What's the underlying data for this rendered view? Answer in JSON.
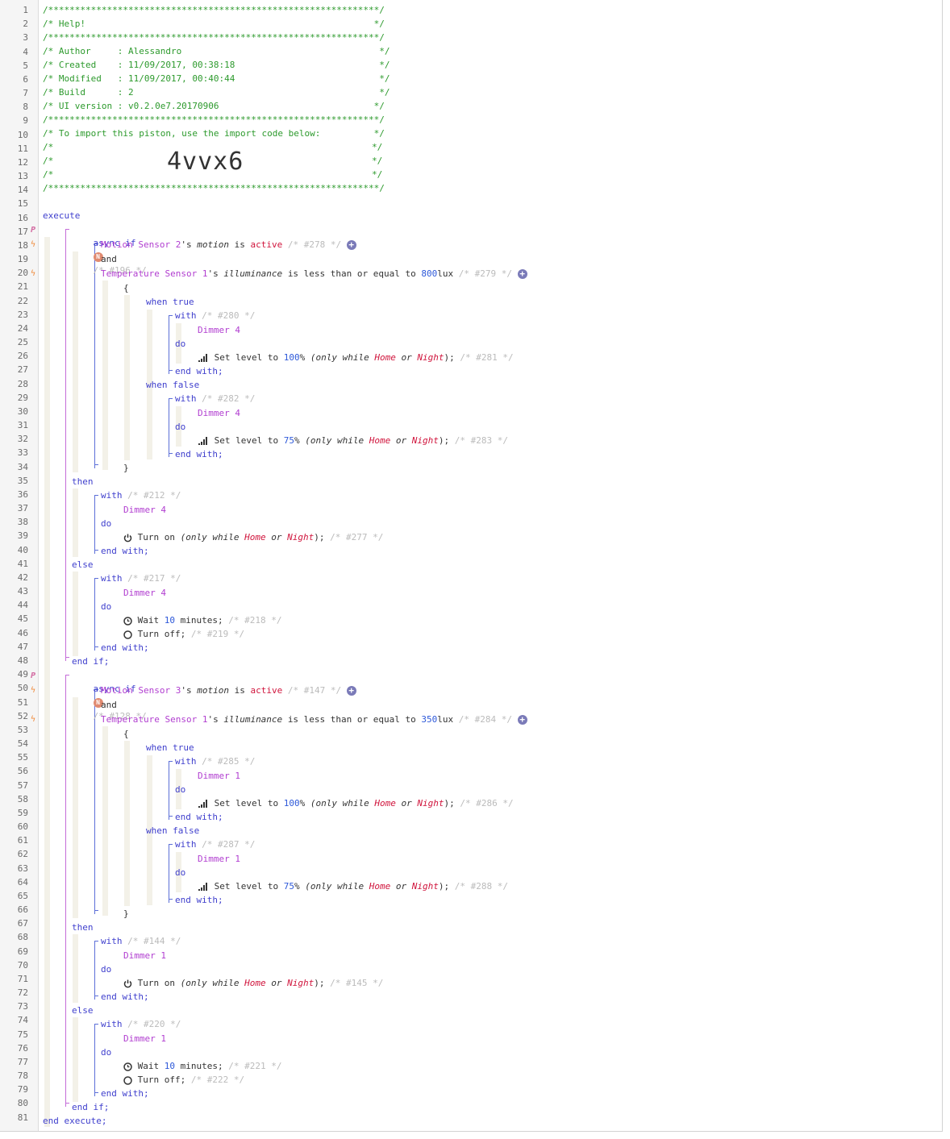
{
  "header": {
    "border": "/**************************************************************/",
    "help": "/* Help!                                                      */",
    "author": "/* Author     : Alessandro                                     */",
    "created": "/* Created    : 11/09/2017, 00:38:18                           */",
    "modified": "/* Modified   : 11/09/2017, 00:40:44                           */",
    "build": "/* Build      : 2                                              */",
    "ui_version": "/* UI version : v0.2.0e7.20170906                             */",
    "import_note": "/* To import this piston, use the import code below:          */",
    "blank_open": "/*",
    "blank_close": "*/",
    "import_code": "4vvx6"
  },
  "kw": {
    "execute": "execute",
    "end_execute": "end execute;",
    "async_if": "async if",
    "and": "and",
    "open_brace": "{",
    "close_brace": "}",
    "when_true": "when true",
    "when_false": "when false",
    "with": "with",
    "do": "do",
    "end_with": "end with;",
    "then": "then",
    "else": "else",
    "end_if": "end if;",
    "badge_n": "N",
    "plus": "+"
  },
  "text": {
    "s_possessive": "'s",
    "motion": "motion",
    "is": "is",
    "active": "active",
    "illuminance": "illuminance",
    "lte": "is less than or equal to",
    "lux": "lux",
    "set_level_to": "Set level to",
    "pct": "%",
    "only_while": "(only while",
    "home": "Home",
    "or": "or",
    "night": "Night",
    "close_paren_semi": ");",
    "turn_on": "Turn on",
    "turn_off": "Turn off;",
    "wait": "Wait",
    "minutes": "minutes;"
  },
  "block1": {
    "if_id": "/* #196 */",
    "motion_sensor": "Motion Sensor 2",
    "motion_id": "/* #278 */",
    "temp_sensor": "Temperature Sensor 1",
    "lux_value": "800",
    "lux_id": "/* #279 */",
    "true_with_id": "/* #280 */",
    "true_device": "Dimmer 4",
    "true_level": "100",
    "true_level_id": "/* #281 */",
    "false_with_id": "/* #282 */",
    "false_device": "Dimmer 4",
    "false_level": "75",
    "false_level_id": "/* #283 */",
    "then_with_id": "/* #212 */",
    "then_device": "Dimmer 4",
    "then_on_id": "/* #277 */",
    "else_with_id": "/* #217 */",
    "else_device": "Dimmer 4",
    "wait_value": "10",
    "wait_id": "/* #218 */",
    "off_id": "/* #219 */"
  },
  "block2": {
    "if_id": "/* #128 */",
    "motion_sensor": "Motion Sensor 3",
    "motion_id": "/* #147 */",
    "temp_sensor": "Temperature Sensor 1",
    "lux_value": "350",
    "lux_id": "/* #284 */",
    "true_with_id": "/* #285 */",
    "true_device": "Dimmer 1",
    "true_level": "100",
    "true_level_id": "/* #286 */",
    "false_with_id": "/* #287 */",
    "false_device": "Dimmer 1",
    "false_level": "75",
    "false_level_id": "/* #288 */",
    "then_with_id": "/* #144 */",
    "then_device": "Dimmer 1",
    "then_on_id": "/* #145 */",
    "else_with_id": "/* #220 */",
    "else_device": "Dimmer 1",
    "wait_value": "10",
    "wait_id": "/* #221 */",
    "off_id": "/* #222 */"
  },
  "line_numbers": [
    "1",
    "2",
    "3",
    "4",
    "5",
    "6",
    "7",
    "8",
    "9",
    "10",
    "11",
    "12",
    "13",
    "14",
    "15",
    "16",
    "17",
    "18",
    "19",
    "20",
    "21",
    "22",
    "23",
    "24",
    "25",
    "26",
    "27",
    "28",
    "29",
    "30",
    "31",
    "32",
    "33",
    "34",
    "35",
    "36",
    "37",
    "38",
    "39",
    "40",
    "41",
    "42",
    "43",
    "44",
    "45",
    "46",
    "47",
    "48",
    "49",
    "50",
    "51",
    "52",
    "53",
    "54",
    "55",
    "56",
    "57",
    "58",
    "59",
    "60",
    "61",
    "62",
    "63",
    "64",
    "65",
    "66",
    "67",
    "68",
    "69",
    "70",
    "71",
    "72",
    "73",
    "74",
    "75",
    "76",
    "77",
    "78",
    "79",
    "80",
    "81"
  ],
  "gutter_marks": {
    "piston_mark": "P",
    "trigger_mark": "ϟ"
  },
  "colors": {
    "comment": "#2d9a2d",
    "keyword": "#3f3fcd",
    "device": "#b13ed0",
    "value_word": "#d0143c",
    "number": "#2e59d9",
    "muted_comment": "#bbbbbb"
  },
  "icons": {
    "level": "signal-bars-icon",
    "power": "power-icon",
    "wait": "clock-icon",
    "off": "circle-off-icon",
    "badge": "n-badge-icon",
    "add": "plus-icon"
  }
}
